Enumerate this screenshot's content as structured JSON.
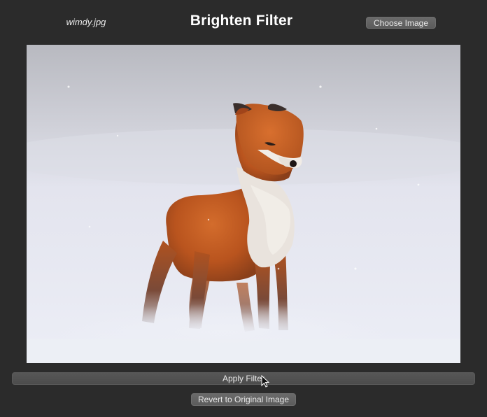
{
  "header": {
    "filename": "wimdy.jpg",
    "title": "Brighten Filter",
    "choose_button": "Choose Image"
  },
  "image": {
    "subject": "red-fox-in-snow"
  },
  "actions": {
    "apply_button": "Apply Filter",
    "revert_button": "Revert to Original Image"
  },
  "colors": {
    "background": "#2b2b2b",
    "button": "#606060"
  }
}
